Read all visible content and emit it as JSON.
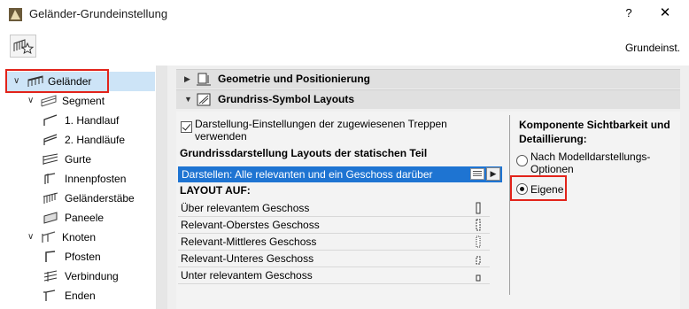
{
  "window": {
    "title": "Geländer-Grundeinstellung",
    "help_label": "?",
    "close_label": "✕"
  },
  "toolbar": {
    "preset_name": "Grundeinst."
  },
  "tree": {
    "items": [
      {
        "label": "Geländer",
        "icon": "railing-icon",
        "chevron": "∨"
      },
      {
        "label": "Segment",
        "icon": "segment-icon",
        "chevron": "∨"
      },
      {
        "label": "1. Handlauf",
        "icon": "handrail-icon"
      },
      {
        "label": "2. Handläufe",
        "icon": "handrail-icon"
      },
      {
        "label": "Gurte",
        "icon": "rails-icon"
      },
      {
        "label": "Innenpfosten",
        "icon": "inner-post-icon"
      },
      {
        "label": "Geländerstäbe",
        "icon": "balusters-icon"
      },
      {
        "label": "Paneele",
        "icon": "panel-icon"
      },
      {
        "label": "Knoten",
        "icon": "node-icon",
        "chevron": "∨"
      },
      {
        "label": "Pfosten",
        "icon": "post-icon"
      },
      {
        "label": "Verbindung",
        "icon": "connection-icon"
      },
      {
        "label": "Enden",
        "icon": "ends-icon"
      }
    ]
  },
  "sections": {
    "geometry": {
      "label": "Geometrie und Positionierung",
      "arrow": "▶"
    },
    "floorplan": {
      "label": "Grundriss-Symbol Layouts",
      "arrow": "▼"
    }
  },
  "floorplan": {
    "checkbox_label": "Darstellung-Einstellungen der zugewiesenen Treppen verwenden",
    "checkbox_checked": true,
    "subheading": "Grundrissdarstellung Layouts der statischen Teil",
    "dropdown_value": "Darstellen: Alle relevanten und ein Geschoss darüber",
    "dropdown_arrow": "▶",
    "layout_header": "LAYOUT AUF:",
    "layout_rows": [
      "Über relevantem Geschoss",
      "Relevant-Oberstes Geschoss",
      "Relevant-Mittleres Geschoss",
      "Relevant-Unteres Geschoss",
      "Unter relevantem Geschoss"
    ]
  },
  "visibility": {
    "heading": "Komponente Sichtbarkeit und Detaillierung:",
    "option_model": "Nach Modelldarstellungs-Optionen",
    "option_own": "Eigene",
    "selected": "Eigene"
  },
  "colors": {
    "highlight": "#1e74d2",
    "annotation_red": "#e2231a",
    "tree_selected": "#cde4f7"
  }
}
